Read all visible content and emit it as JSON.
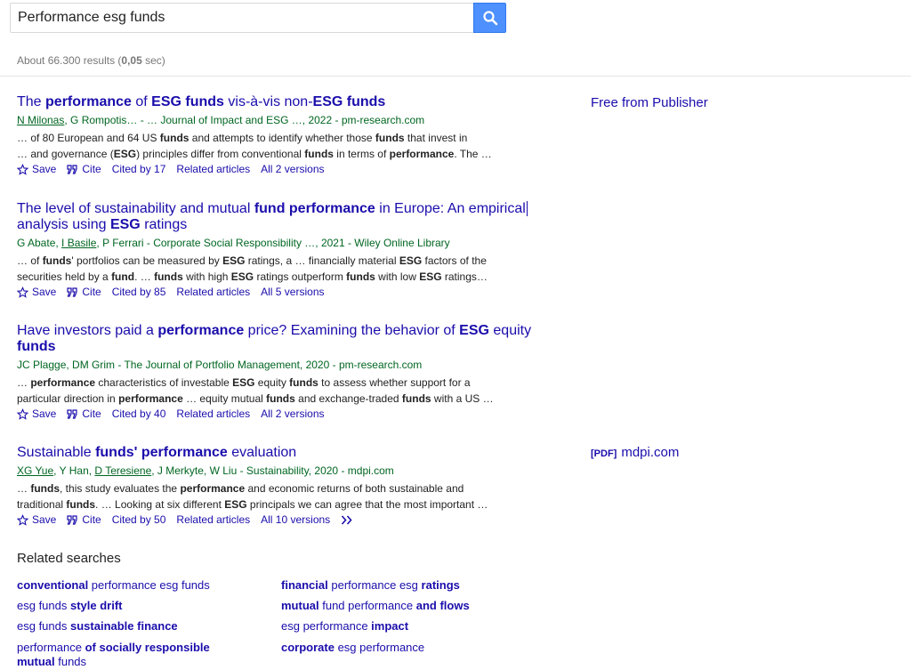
{
  "search": {
    "query": "Performance esg funds"
  },
  "stats": {
    "prefix": "About 66.300 results (",
    "time": "0,05",
    "suffix": " sec)"
  },
  "actions": {
    "save": "Save",
    "cite": "Cite",
    "related": "Related articles"
  },
  "results": [
    {
      "title": [
        [
          "The ",
          0
        ],
        [
          "performance",
          1
        ],
        [
          " of ",
          0
        ],
        [
          "ESG funds",
          1
        ],
        [
          " vis-à-vis non-",
          0
        ],
        [
          "ESG funds",
          1
        ]
      ],
      "authors": [
        [
          "N Milonas",
          1
        ],
        [
          ", G Rompotis… - … Journal of Impact and ESG …, 2022 - pm-research.com",
          0
        ]
      ],
      "snippet1": [
        [
          "… of 80 European and 64 US ",
          0
        ],
        [
          "funds",
          1
        ],
        [
          " and attempts to identify whether those ",
          0
        ],
        [
          "funds",
          1
        ],
        [
          " that invest in",
          0
        ]
      ],
      "snippet2": [
        [
          "… and governance (",
          0
        ],
        [
          "ESG",
          1
        ],
        [
          ") principles differ from conventional ",
          0
        ],
        [
          "funds",
          1
        ],
        [
          " in terms of ",
          0
        ],
        [
          "performance",
          1
        ],
        [
          ". The …",
          0
        ]
      ],
      "cited": "Cited by 17",
      "versions": "All 2 versions",
      "side": "Free from Publisher"
    },
    {
      "title": [
        [
          "The level of sustainability and mutual ",
          0
        ],
        [
          "fund performance",
          1
        ],
        [
          " in Europe: An empirical analysis using ",
          0
        ],
        [
          "ESG",
          1
        ],
        [
          " ratings",
          0
        ]
      ],
      "authors": [
        [
          "G Abate, ",
          0
        ],
        [
          "I Basile",
          1
        ],
        [
          ", P Ferrari - Corporate Social Responsibility …, 2021 - Wiley Online Library",
          0
        ]
      ],
      "snippet1": [
        [
          "… of ",
          0
        ],
        [
          "funds",
          1
        ],
        [
          "' portfolios can be measured by ",
          0
        ],
        [
          "ESG",
          1
        ],
        [
          " ratings, a … financially material ",
          0
        ],
        [
          "ESG",
          1
        ],
        [
          " factors of the",
          0
        ]
      ],
      "snippet2": [
        [
          "securities held by a ",
          0
        ],
        [
          "fund",
          1
        ],
        [
          ". … ",
          0
        ],
        [
          "funds",
          1
        ],
        [
          " with high ",
          0
        ],
        [
          "ESG",
          1
        ],
        [
          " ratings outperform ",
          0
        ],
        [
          "funds",
          1
        ],
        [
          " with low ",
          0
        ],
        [
          "ESG",
          1
        ],
        [
          " ratings…",
          0
        ]
      ],
      "cited": "Cited by 85",
      "versions": "All 5 versions"
    },
    {
      "title": [
        [
          "Have investors paid a ",
          0
        ],
        [
          "performance",
          1
        ],
        [
          " price? Examining the behavior of ",
          0
        ],
        [
          "ESG",
          1
        ],
        [
          " equity ",
          0
        ],
        [
          "funds",
          1
        ]
      ],
      "authors": [
        [
          "JC Plagge, DM Grim - The Journal of Portfolio Management, 2020 - pm-research.com",
          0
        ]
      ],
      "snippet1": [
        [
          "… ",
          0
        ],
        [
          "performance",
          1
        ],
        [
          " characteristics of investable ",
          0
        ],
        [
          "ESG",
          1
        ],
        [
          " equity ",
          0
        ],
        [
          "funds",
          1
        ],
        [
          " to assess whether support for a",
          0
        ]
      ],
      "snippet2": [
        [
          "particular direction in ",
          0
        ],
        [
          "performance",
          1
        ],
        [
          " … equity mutual ",
          0
        ],
        [
          "funds",
          1
        ],
        [
          " and exchange-traded ",
          0
        ],
        [
          "funds",
          1
        ],
        [
          " with a US …",
          0
        ]
      ],
      "cited": "Cited by 40",
      "versions": "All 2 versions"
    },
    {
      "title": [
        [
          "Sustainable ",
          0
        ],
        [
          "funds' performance",
          1
        ],
        [
          " evaluation",
          0
        ]
      ],
      "authors": [
        [
          "XG Yue",
          1
        ],
        [
          ", Y Han, ",
          0
        ],
        [
          "D Teresiene",
          1
        ],
        [
          ", J Merkyte, W Liu - Sustainability, 2020 - mdpi.com",
          0
        ]
      ],
      "snippet1": [
        [
          "… ",
          0
        ],
        [
          "funds",
          1
        ],
        [
          ", this study evaluates the ",
          0
        ],
        [
          "performance",
          1
        ],
        [
          " and economic returns of both sustainable and",
          0
        ]
      ],
      "snippet2": [
        [
          "traditional ",
          0
        ],
        [
          "funds",
          1
        ],
        [
          ". … Looking at six different ",
          0
        ],
        [
          "ESG",
          1
        ],
        [
          " principals we can agree that the most important …",
          0
        ]
      ],
      "cited": "Cited by 50",
      "versions": "All 10 versions",
      "side_pdf": "[PDF]",
      "side": "mdpi.com"
    }
  ],
  "related_heading": "Related searches",
  "related": [
    [
      [
        "conventional",
        1
      ],
      [
        " performance esg funds",
        0
      ]
    ],
    [
      [
        "financial",
        1
      ],
      [
        " performance esg ",
        0
      ],
      [
        "ratings",
        1
      ]
    ],
    [
      [
        "esg funds ",
        0
      ],
      [
        "style drift",
        1
      ]
    ],
    [
      [
        "mutual",
        1
      ],
      [
        " fund performance ",
        0
      ],
      [
        "and flows",
        1
      ]
    ],
    [
      [
        "esg funds ",
        0
      ],
      [
        "sustainable finance",
        1
      ]
    ],
    [
      [
        "esg performance ",
        0
      ],
      [
        "impact",
        1
      ]
    ],
    [
      [
        "performance ",
        0
      ],
      [
        "of socially responsible",
        1
      ],
      [
        " ",
        0
      ],
      [
        "mutual",
        1
      ],
      [
        " funds",
        0
      ]
    ],
    [
      [
        "corporate",
        1
      ],
      [
        " esg performance",
        0
      ]
    ]
  ],
  "colors": {
    "link": "#1a0dab",
    "green": "#006621",
    "button": "#4d90fe"
  }
}
